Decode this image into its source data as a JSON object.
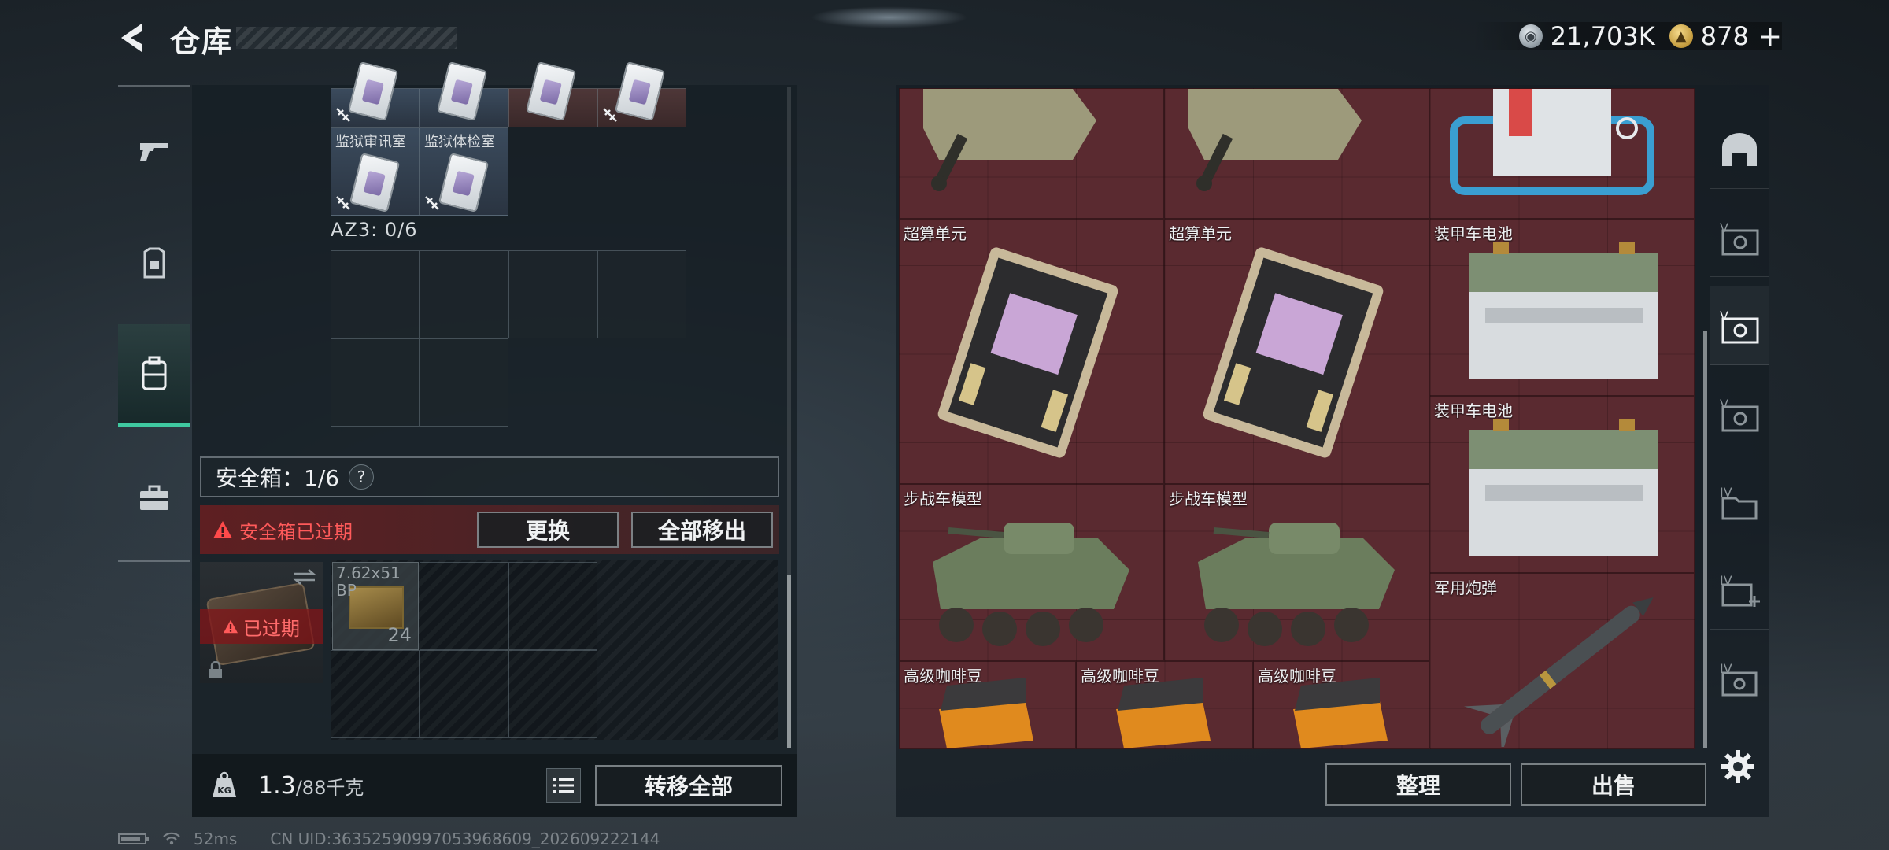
{
  "header": {
    "title": "仓库",
    "currency_silver": "21,703K",
    "currency_gold": "878",
    "plus": "+"
  },
  "left_panel": {
    "top_cells": [
      {
        "label": ""
      },
      {
        "label": ""
      },
      {
        "label": ""
      },
      {
        "label": ""
      }
    ],
    "row2_cells": [
      {
        "label": "监狱审讯室"
      },
      {
        "label": "监狱体检室"
      }
    ],
    "az3_label": "AZ3: 0/6",
    "safe_box_label": "安全箱：1/6",
    "help": "?",
    "expired_warning": "安全箱已过期",
    "replace_button": "更换",
    "move_all_out_button": "全部移出",
    "case_expired": "已过期",
    "ammo": {
      "name": "7.62x51 BP",
      "count": "24"
    },
    "weight_value": "1.3",
    "weight_max": "/88千克",
    "transfer_all_button": "转移全部"
  },
  "stash": {
    "items": [
      {
        "label": "",
        "art": "tank"
      },
      {
        "label": "",
        "art": "tank"
      },
      {
        "label": "",
        "art": "machine"
      },
      {
        "label": "超算单元",
        "art": "board"
      },
      {
        "label": "超算单元",
        "art": "board"
      },
      {
        "label": "装甲车电池",
        "art": "battery"
      },
      {
        "label": "装甲车电池",
        "art": "battery"
      },
      {
        "label": "步战车模型",
        "art": "ifv"
      },
      {
        "label": "步战车模型",
        "art": "ifv"
      },
      {
        "label": "军用炮弹",
        "art": "missile"
      },
      {
        "label": "高级咖啡豆",
        "art": "coffee"
      },
      {
        "label": "高级咖啡豆",
        "art": "coffee"
      },
      {
        "label": "高级咖啡豆",
        "art": "coffee"
      }
    ],
    "sort_button": "整理",
    "sell_button": "出售"
  },
  "right_tabs": [
    {
      "icon": "helmet-icon"
    },
    {
      "icon": "case-v-icon"
    },
    {
      "icon": "case-v-icon"
    },
    {
      "icon": "case-v-icon"
    },
    {
      "icon": "folder-iv-icon"
    },
    {
      "icon": "case-iv-plus-icon"
    },
    {
      "icon": "case-iv-icon"
    }
  ],
  "status": {
    "ping": "52ms",
    "uid": "CN UID:36352590997053968609_202609222144"
  },
  "colors": {
    "accent": "#3fc9a0",
    "stash_bg": "#5a2a30",
    "warning": "#ff5a5a"
  }
}
